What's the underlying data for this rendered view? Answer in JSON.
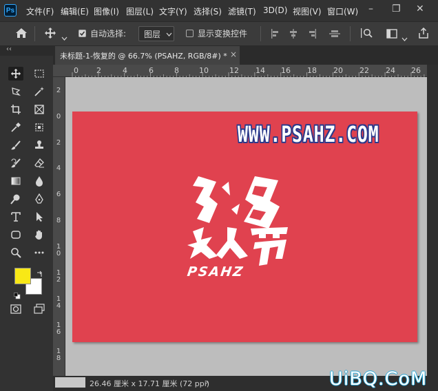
{
  "app": {
    "logo": "Ps"
  },
  "menu": [
    "文件(F)",
    "编辑(E)",
    "图像(I)",
    "图层(L)",
    "文字(Y)",
    "选择(S)",
    "滤镜(T)",
    "3D(D)",
    "视图(V)",
    "窗口(W)"
  ],
  "window_controls": {
    "minimize": "–",
    "restore": "❐",
    "close": "✕"
  },
  "options_bar": {
    "auto_select_label": "自动选择:",
    "auto_select_checked": true,
    "layer_dropdown_value": "图层",
    "show_transform_label": "显示变换控件",
    "show_transform_checked": false
  },
  "document_tab": {
    "title": "未标题-1-恢复的 @ 66.7% (PSAHZ, RGB/8#) *",
    "close": "×"
  },
  "toolbar": {
    "collapse": "‹‹"
  },
  "ruler": {
    "h_labels": [
      "0",
      "2",
      "4",
      "6",
      "8",
      "10",
      "12",
      "14",
      "16",
      "18",
      "20",
      "22",
      "24",
      "26"
    ],
    "v_labels": [
      "2",
      "0",
      "2",
      "4",
      "6",
      "8",
      "10",
      "12",
      "14",
      "16",
      "18"
    ]
  },
  "canvas": {
    "background_color": "#e0424f",
    "url_text": "WWW.PSAHZ.COM",
    "artwork_text": "PSAHZ"
  },
  "status_bar": {
    "doc_size": "26.46 厘米 x 17.71 厘米 (72 ppi)",
    "arrow": "›"
  },
  "colors": {
    "foreground": "#f8e816",
    "background": "#ffffff",
    "accent": "#31a8ff"
  },
  "watermark": "UiBQ.CoM"
}
